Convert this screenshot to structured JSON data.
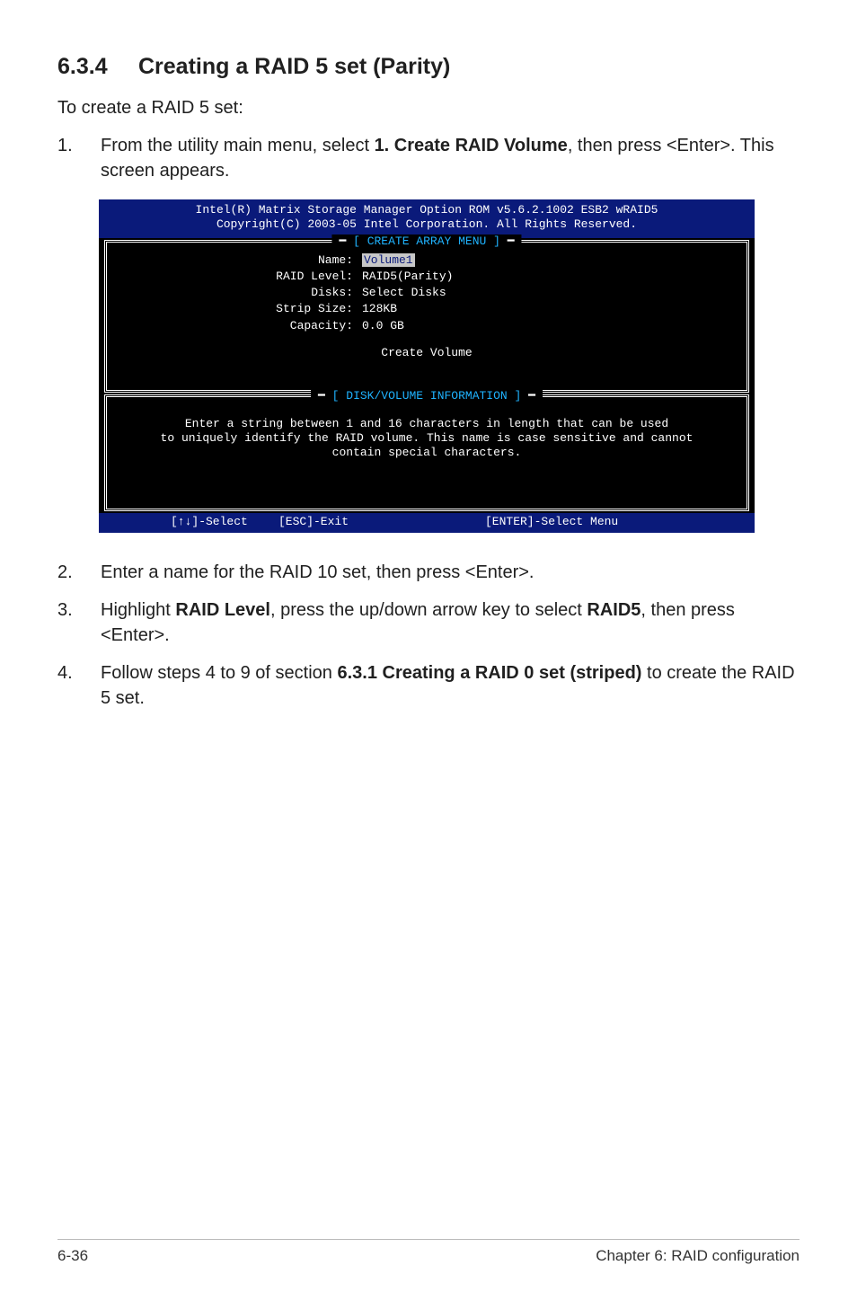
{
  "section": {
    "number": "6.3.4",
    "title": "Creating a RAID 5 set (Parity)"
  },
  "intro": "To create a RAID 5 set:",
  "step1": {
    "num": "1.",
    "prefix": "From the utility main menu, select ",
    "bold": "1. Create RAID Volume",
    "suffix": ", then press <Enter>. This screen appears."
  },
  "terminal": {
    "header_line1": "Intel(R) Matrix Storage Manager Option ROM v5.6.2.1002 ESB2 wRAID5",
    "header_line2": "Copyright(C) 2003-05 Intel Corporation. All Rights Reserved.",
    "panel_create_title": "[ CREATE ARRAY MENU ]",
    "panel_info_title": "[ DISK/VOLUME INFORMATION ]",
    "fields": {
      "name_label": "Name:",
      "name_value": "Volume1",
      "raidlevel_label": "RAID Level:",
      "raidlevel_value": "RAID5(Parity)",
      "disks_label": "Disks:",
      "disks_value": "Select Disks",
      "strip_label": "Strip Size:",
      "strip_value": "128KB",
      "capacity_label": "Capacity:",
      "capacity_value": "0.0   GB"
    },
    "create_volume": "Create Volume",
    "info_line1": "Enter a string between 1 and 16 characters in length that can be used",
    "info_line2": "to uniquely identify the RAID volume. This name is case sensitive and cannot",
    "info_line3": "contain special characters.",
    "footer_select": "[↑↓]-Select",
    "footer_exit": "[ESC]-Exit",
    "footer_enter": "[ENTER]-Select Menu"
  },
  "step2": {
    "num": "2.",
    "text": "Enter a name for the RAID 10 set, then press <Enter>."
  },
  "step3": {
    "num": "3.",
    "prefix": "Highlight ",
    "bold1": "RAID Level",
    "mid": ", press the up/down arrow key to select ",
    "bold2": "RAID5",
    "suffix": ", then press <Enter>."
  },
  "step4": {
    "num": "4.",
    "prefix": "Follow steps 4 to 9 of section ",
    "bold": "6.3.1 Creating a RAID 0 set (striped)",
    "suffix": " to create the RAID 5 set."
  },
  "footer": {
    "left": "6-36",
    "right": "Chapter 6: RAID configuration"
  }
}
